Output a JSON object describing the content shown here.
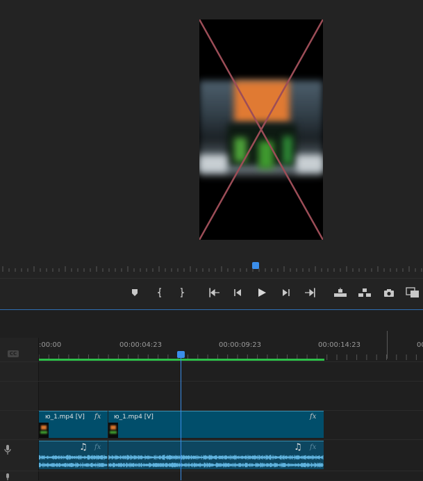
{
  "program_monitor": {
    "transport": {
      "buttons": [
        {
          "name": "add-marker",
          "icon": "marker-icon"
        },
        {
          "name": "mark-in",
          "icon": "mark-in-icon"
        },
        {
          "name": "mark-out",
          "icon": "mark-out-icon"
        },
        {
          "name": "go-to-in",
          "icon": "go-to-in-icon"
        },
        {
          "name": "step-back",
          "icon": "step-back-icon"
        },
        {
          "name": "play",
          "icon": "play-icon"
        },
        {
          "name": "step-forward",
          "icon": "step-forward-icon"
        },
        {
          "name": "go-to-out",
          "icon": "go-to-out-icon"
        },
        {
          "name": "lift",
          "icon": "lift-icon"
        },
        {
          "name": "extract",
          "icon": "extract-icon"
        },
        {
          "name": "export-frame",
          "icon": "camera-icon"
        },
        {
          "name": "comparison-view",
          "icon": "comparison-view-icon"
        }
      ]
    }
  },
  "timeline": {
    "ruler": {
      "timecodes": [
        ":00:00",
        "00:00:04:23",
        "00:00:09:23",
        "00:00:14:23",
        "00"
      ]
    },
    "captions_badge": "CC",
    "video_clips": [
      {
        "label": "ю_1.mp4 [V]",
        "fx": "fx"
      },
      {
        "label": "ю_1.mp4 [V]",
        "fx": "fx"
      }
    ],
    "audio_clips": [
      {
        "note": "♫",
        "fx": "fx"
      },
      {
        "note": "♫",
        "fx": "fx"
      }
    ],
    "colors": {
      "playhead": "#3b8eea",
      "work_area": "#2ec04a",
      "video_clip": "#014e6b",
      "audio_clip": "#0d4660",
      "waveform": "#5fb2dd"
    }
  }
}
